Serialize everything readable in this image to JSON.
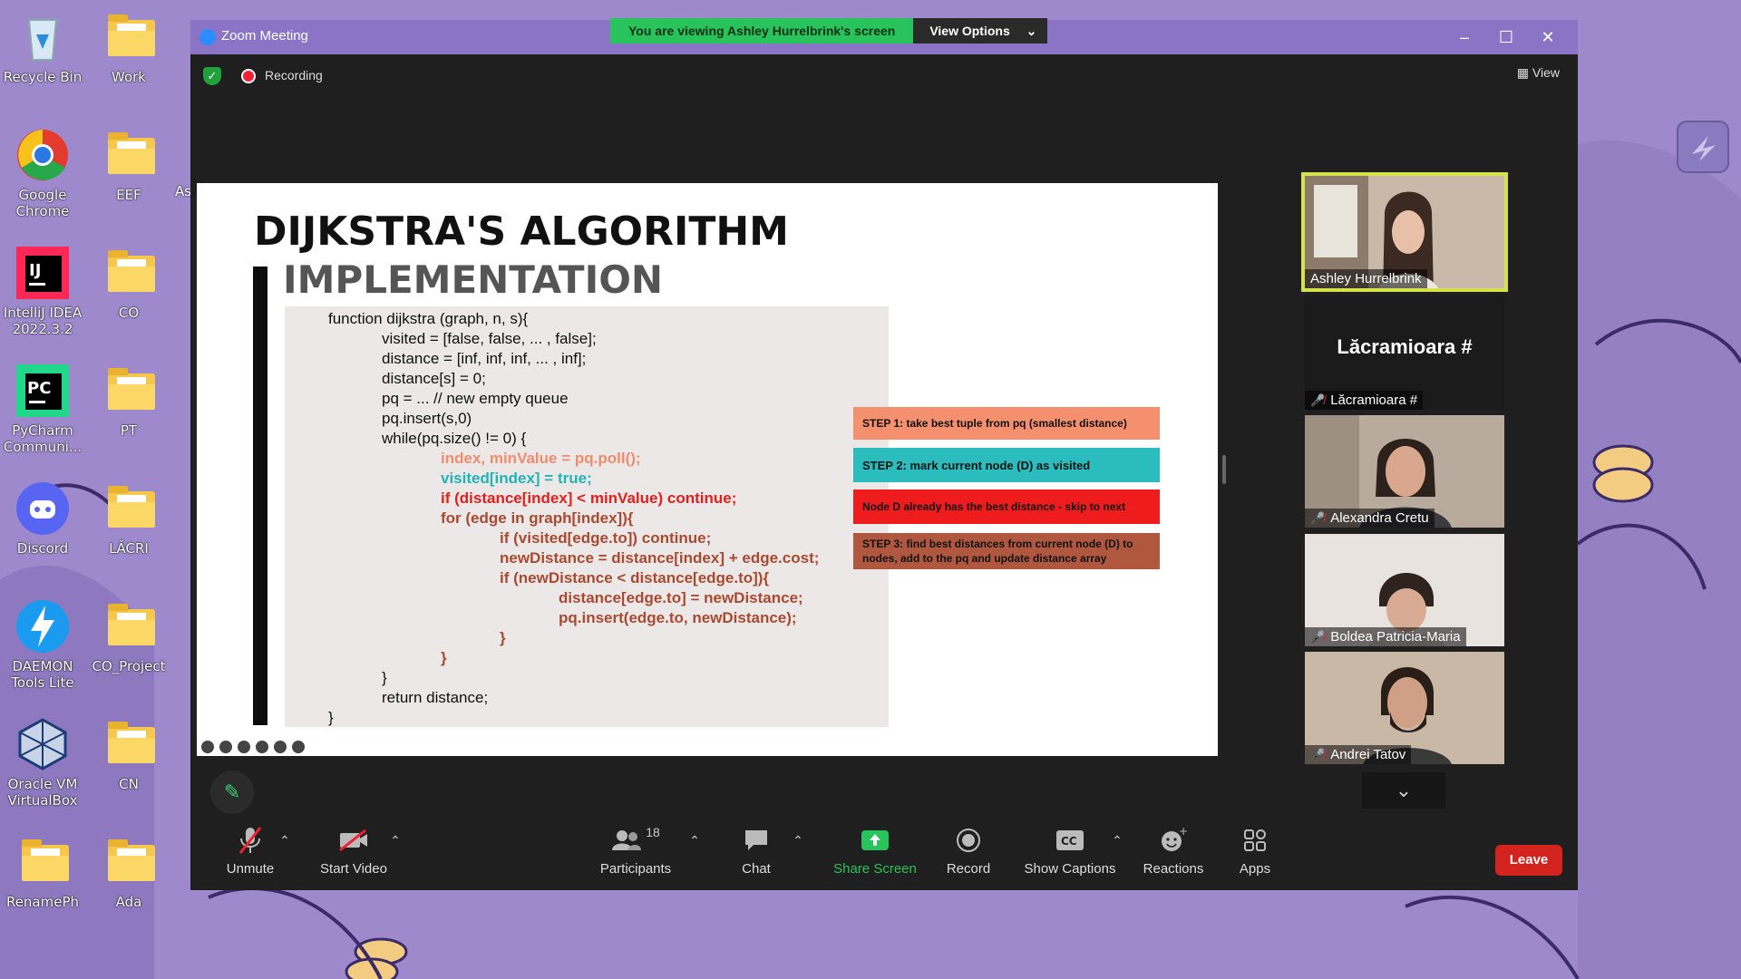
{
  "desktop": {
    "icons_col1": [
      {
        "label": "Recycle Bin",
        "icon": "recycle-bin-icon"
      },
      {
        "label": "Google Chrome",
        "icon": "chrome-icon"
      },
      {
        "label": "IntelliJ IDEA 2022.3.2",
        "icon": "intellij-icon"
      },
      {
        "label": "PyCharm Communi...",
        "icon": "pycharm-icon"
      },
      {
        "label": "Discord",
        "icon": "discord-icon"
      },
      {
        "label": "DAEMON Tools Lite",
        "icon": "daemon-tools-icon"
      },
      {
        "label": "Oracle VM VirtualBox",
        "icon": "virtualbox-icon"
      },
      {
        "label": "RenamePh",
        "icon": "folder-icon"
      }
    ],
    "icons_col2": [
      {
        "label": "Work"
      },
      {
        "label": "EEF"
      },
      {
        "label": "CO"
      },
      {
        "label": "PT"
      },
      {
        "label": "LĂCRI"
      },
      {
        "label": "CO_Project"
      },
      {
        "label": "CN"
      },
      {
        "label": "Ada"
      }
    ],
    "partial_label": "As"
  },
  "window": {
    "title": "Zoom Meeting",
    "banner_text": "You are viewing Ashley Hurrelbrink's screen",
    "view_options": "View Options",
    "recording": "Recording",
    "view": "View"
  },
  "slide": {
    "title": "DIJKSTRA'S ALGORITHM",
    "subtitle": "IMPLEMENTATION",
    "code": [
      "function dijkstra (graph, n, s){",
      "visited = [false, false, ... , false];",
      "distance = [inf, inf, inf, ... , inf];",
      "distance[s] = 0;",
      "pq = ... // new empty queue",
      "pq.insert(s,0)",
      "while(pq.size() != 0) {",
      "index, minValue = pq.poll();",
      "visited[index] = true;",
      "if (distance[index] < minValue) continue;",
      "for (edge in graph[index]){",
      "if (visited[edge.to]) continue;",
      "newDistance = distance[index] + edge.cost;",
      "if (newDistance < distance[edge.to]){",
      "distance[edge.to] = newDistance;",
      "pq.insert(edge.to, newDistance);",
      "}",
      "}",
      "}",
      "return distance;",
      "}"
    ],
    "steps": [
      {
        "text": "STEP 1: take best tuple from pq (smallest distance)",
        "color": "#f5906e"
      },
      {
        "text": "STEP 2: mark current node (D) as visited",
        "color": "#2bbdbd"
      },
      {
        "text": "Node D already has the best distance - skip to next",
        "color": "#ee1c1c"
      },
      {
        "text": "STEP 3: find best distances from current node (D) to nodes, add to the pq and update distance array",
        "color": "#b0583f"
      }
    ]
  },
  "participants": [
    {
      "name": "Ashley Hurrelbrink",
      "muted": false,
      "active": true
    },
    {
      "name": "Lăcramioara #",
      "muted": true,
      "placeholder_name": "Lăcramioara #"
    },
    {
      "name": "Alexandra Cretu",
      "muted": true
    },
    {
      "name": "Boldea Patricia-Maria",
      "muted": true
    },
    {
      "name": "Andrei Tatov",
      "muted": true
    }
  ],
  "toolbar": {
    "unmute": "Unmute",
    "start_video": "Start Video",
    "participants": "Participants",
    "participants_count": "18",
    "chat": "Chat",
    "share_screen": "Share Screen",
    "record": "Record",
    "show_captions": "Show Captions",
    "reactions": "Reactions",
    "apps": "Apps",
    "leave": "Leave"
  },
  "colors": {
    "desktop_bg": "#9a86c9",
    "zoom_bg": "#1f1f1f",
    "share_green": "#29c35b",
    "leave_red": "#d3231d",
    "active_speaker": "#d4e34a"
  }
}
